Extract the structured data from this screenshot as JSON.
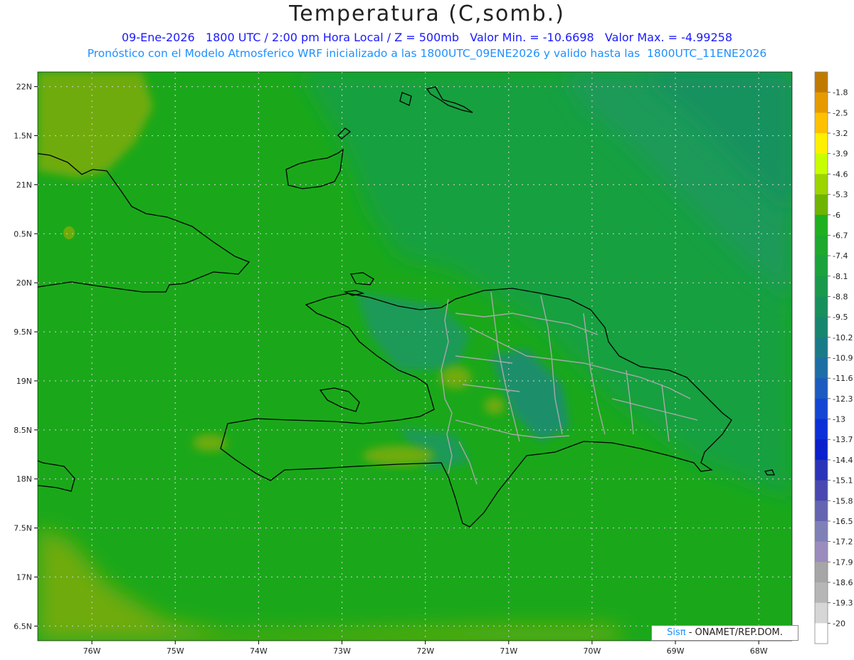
{
  "title": "Temperatura (C,somb.)",
  "subtitle_line1": "09-Ene-2026   1800 UTC / 2:00 pm Hora Local / Z = 500mb   Valor Min. = -10.6698   Valor Max. = -4.99258",
  "subtitle_line2": "Pronóstico con el Modelo Atmosferico WRF inicializado a las 1800UTC_09ENE2026 y valido hasta las  1800UTC_11ENE2026",
  "credit": {
    "brand": "Sisπ",
    "text": " - ONAMET/REP.DOM."
  },
  "map": {
    "lat_range": [
      16.35,
      22.15
    ],
    "lon_range": [
      -76.65,
      -67.6
    ],
    "lat_ticks": [
      {
        "value": 22.0,
        "label": "22N"
      },
      {
        "value": 21.5,
        "label": "1.5N"
      },
      {
        "value": 21.0,
        "label": "21N"
      },
      {
        "value": 20.5,
        "label": "0.5N"
      },
      {
        "value": 20.0,
        "label": "20N"
      },
      {
        "value": 19.5,
        "label": "9.5N"
      },
      {
        "value": 19.0,
        "label": "19N"
      },
      {
        "value": 18.5,
        "label": "8.5N"
      },
      {
        "value": 18.0,
        "label": "18N"
      },
      {
        "value": 17.5,
        "label": "7.5N"
      },
      {
        "value": 17.0,
        "label": "17N"
      },
      {
        "value": 16.5,
        "label": "6.5N"
      }
    ],
    "lon_ticks": [
      {
        "value": -76,
        "label": "76W"
      },
      {
        "value": -75,
        "label": "75W"
      },
      {
        "value": -74,
        "label": "74W"
      },
      {
        "value": -73,
        "label": "73W"
      },
      {
        "value": -72,
        "label": "72W"
      },
      {
        "value": -71,
        "label": "71W"
      },
      {
        "value": -70,
        "label": "70W"
      },
      {
        "value": -69,
        "label": "69W"
      },
      {
        "value": -68,
        "label": "68W"
      }
    ],
    "colors": {
      "base": "#1aa81a",
      "warm": "#6fab0a",
      "cool": "#17a040",
      "cooler": "#1c9a58",
      "coolest": "#18925e",
      "coast": "#000000",
      "borders": "#a8a8a8",
      "grid": "#c8c8c8"
    }
  },
  "colorbar": {
    "labels": [
      "-1.8",
      "-2.5",
      "-3.2",
      "-3.9",
      "-4.6",
      "-5.3",
      "-6",
      "-6.7",
      "-7.4",
      "-8.1",
      "-8.8",
      "-9.5",
      "-10.2",
      "-10.9",
      "-11.6",
      "-12.3",
      "-13",
      "-13.7",
      "-14.4",
      "-15.1",
      "-15.8",
      "-16.5",
      "-17.2",
      "-17.9",
      "-18.6",
      "-19.3",
      "-20"
    ],
    "colors": [
      "#c07a00",
      "#e69a00",
      "#ffc000",
      "#fff000",
      "#c8ff00",
      "#9cd400",
      "#6fb400",
      "#1fb01f",
      "#1ca92e",
      "#1aa23c",
      "#19994c",
      "#18905c",
      "#17866e",
      "#1a7b88",
      "#1e6ea6",
      "#1c5cc0",
      "#1446d4",
      "#0c30d8",
      "#0a20cc",
      "#2a34b8",
      "#4848b0",
      "#6464b0",
      "#8080b8",
      "#9a8cbc",
      "#a6a6a6",
      "#b6b6b6",
      "#d6d6d6",
      "#ffffff"
    ]
  }
}
